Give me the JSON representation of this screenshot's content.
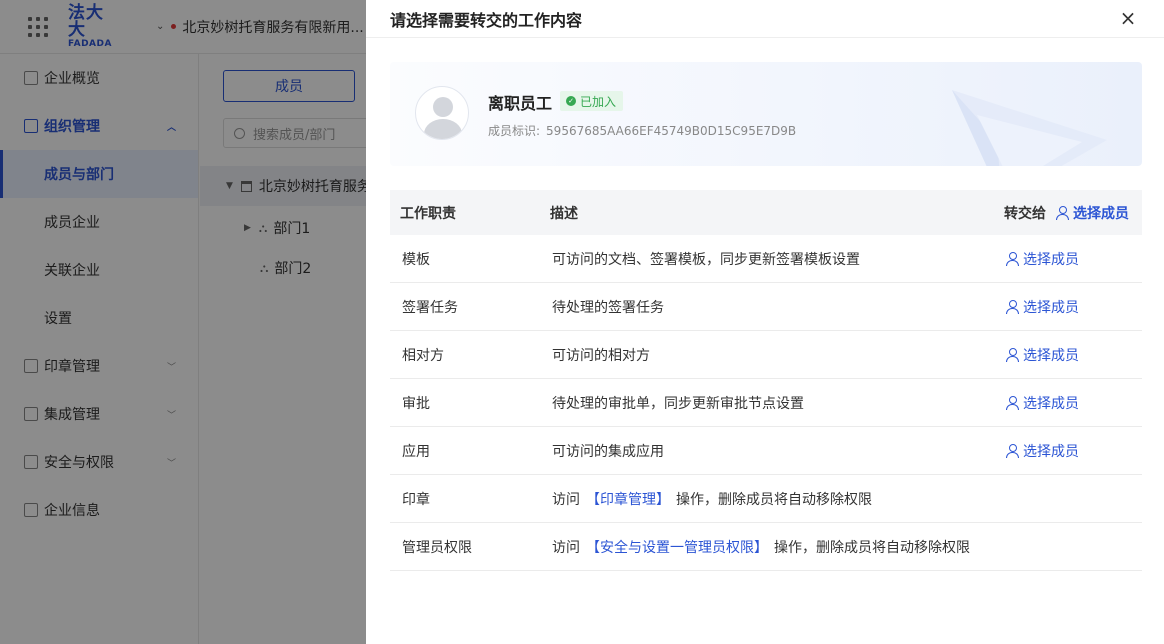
{
  "topbar": {
    "logo_main": "法大大",
    "logo_sub": "FADADA",
    "org_name": "北京妙树托育服务有限新用..."
  },
  "sidebar": {
    "items": [
      {
        "label": "企业概览"
      },
      {
        "label": "组织管理"
      },
      {
        "label": "成员与部门"
      },
      {
        "label": "成员企业"
      },
      {
        "label": "关联企业"
      },
      {
        "label": "设置"
      },
      {
        "label": "印章管理"
      },
      {
        "label": "集成管理"
      },
      {
        "label": "安全与权限"
      },
      {
        "label": "企业信息"
      }
    ]
  },
  "content": {
    "member_tab": "成员",
    "search_placeholder": "搜索成员/部门",
    "tree_root": "北京妙树托育服务",
    "tree_children": [
      "部门1",
      "部门2"
    ]
  },
  "drawer": {
    "title": "请选择需要转交的工作内容",
    "close": "×",
    "profile": {
      "name": "离职员工",
      "badge": "已加入",
      "id_label": "成员标识:",
      "id_value": "59567685AA66EF45749B0D15C95E7D9B"
    },
    "table": {
      "headers": {
        "duty": "工作职责",
        "desc": "描述",
        "transfer": "转交给",
        "select_all": "选择成员"
      },
      "select_label": "选择成员",
      "rows": [
        {
          "duty": "模板",
          "desc": "可访问的文档、签署模板，同步更新签署模板设置"
        },
        {
          "duty": "签署任务",
          "desc": "待处理的签署任务"
        },
        {
          "duty": "相对方",
          "desc": "可访问的相对方"
        },
        {
          "duty": "审批",
          "desc": "待处理的审批单，同步更新审批节点设置"
        },
        {
          "duty": "应用",
          "desc": "可访问的集成应用"
        }
      ],
      "info_rows": [
        {
          "duty": "印章",
          "prefix": "访问",
          "link": "【印章管理】",
          "suffix": "操作，删除成员将自动移除权限"
        },
        {
          "duty": "管理员权限",
          "prefix": "访问",
          "link": "【安全与设置一管理员权限】",
          "suffix": "操作，删除成员将自动移除权限"
        }
      ]
    }
  },
  "colors": {
    "accent": "#2c55d4",
    "success": "#36a852"
  }
}
